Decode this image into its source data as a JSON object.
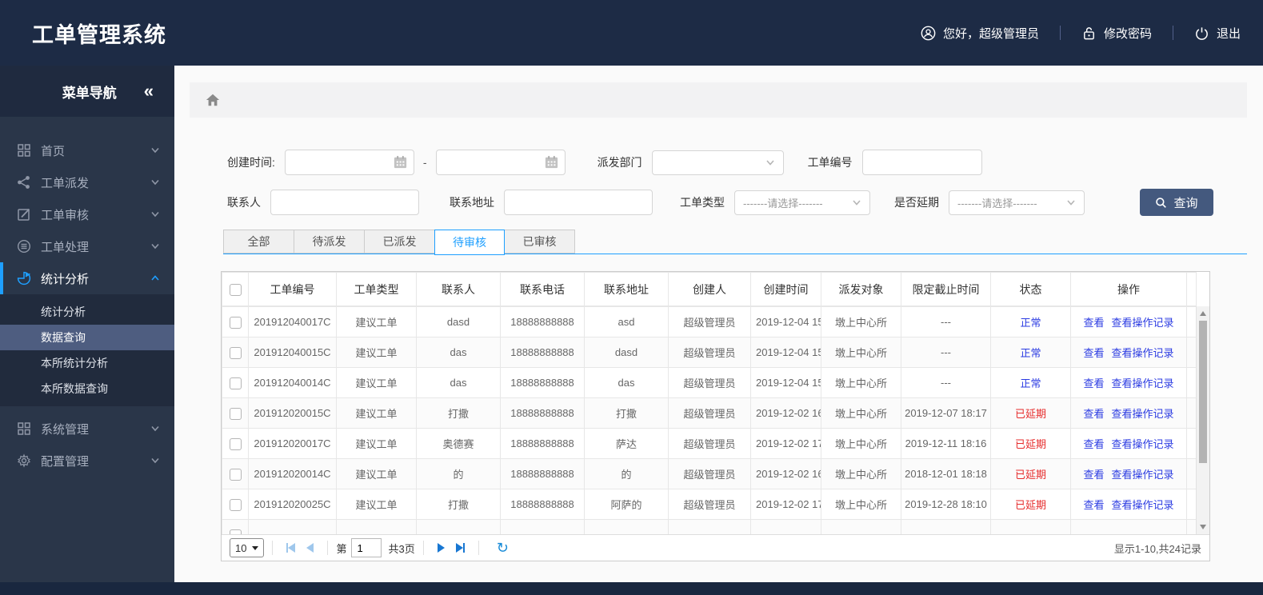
{
  "topbar": {
    "title": "工单管理系统",
    "greeting": "您好，超级管理员",
    "change_password": "修改密码",
    "logout": "退出"
  },
  "sidebar": {
    "header": "菜单导航",
    "collapse_icon": "«",
    "items": [
      {
        "label": "首页",
        "icon": "grid-icon"
      },
      {
        "label": "工单派发",
        "icon": "share-icon"
      },
      {
        "label": "工单审核",
        "icon": "edit-icon"
      },
      {
        "label": "工单处理",
        "icon": "database-icon"
      },
      {
        "label": "统计分析",
        "icon": "pie-icon",
        "active": true,
        "expanded": true,
        "children": [
          {
            "label": "统计分析"
          },
          {
            "label": "数据查询",
            "selected": true
          },
          {
            "label": "本所统计分析"
          },
          {
            "label": "本所数据查询"
          }
        ]
      },
      {
        "label": "系统管理",
        "icon": "apps-icon"
      },
      {
        "label": "配置管理",
        "icon": "gear-icon"
      }
    ]
  },
  "filters": {
    "create_time_label": "创建时间:",
    "date_separator": "-",
    "depart_label": "派发部门",
    "order_no_label": "工单编号",
    "contact_label": "联系人",
    "address_label": "联系地址",
    "type_label": "工单类型",
    "type_placeholder": "-------请选择-------",
    "delay_label": "是否延期",
    "delay_placeholder": "-------请选择-------",
    "search_button": "查询"
  },
  "tabs": [
    {
      "label": "全部"
    },
    {
      "label": "待派发"
    },
    {
      "label": "已派发"
    },
    {
      "label": "待审核",
      "active": true
    },
    {
      "label": "已审核"
    }
  ],
  "table": {
    "columns": [
      "工单编号",
      "工单类型",
      "联系人",
      "联系电话",
      "联系地址",
      "创建人",
      "创建时间",
      "派发对象",
      "限定截止时间",
      "状态",
      "操作"
    ],
    "rows": [
      {
        "order_no": "201912040017C",
        "type": "建议工单",
        "contact": "dasd",
        "phone": "18888888888",
        "address": "asd",
        "creator": "超级管理员",
        "created": "2019-12-04 15",
        "target": "墩上中心所",
        "deadline": "---",
        "status": "正常",
        "status_type": "normal",
        "actions": [
          "查看",
          "查看操作记录"
        ]
      },
      {
        "order_no": "201912040015C",
        "type": "建议工单",
        "contact": "das",
        "phone": "18888888888",
        "address": "dasd",
        "creator": "超级管理员",
        "created": "2019-12-04 15",
        "target": "墩上中心所",
        "deadline": "---",
        "status": "正常",
        "status_type": "normal",
        "actions": [
          "查看",
          "查看操作记录"
        ]
      },
      {
        "order_no": "201912040014C",
        "type": "建议工单",
        "contact": "das",
        "phone": "18888888888",
        "address": "das",
        "creator": "超级管理员",
        "created": "2019-12-04 15",
        "target": "墩上中心所",
        "deadline": "---",
        "status": "正常",
        "status_type": "normal",
        "actions": [
          "查看",
          "查看操作记录"
        ]
      },
      {
        "order_no": "201912020015C",
        "type": "建议工单",
        "contact": "打撒",
        "phone": "18888888888",
        "address": "打撒",
        "creator": "超级管理员",
        "created": "2019-12-02 16",
        "target": "墩上中心所",
        "deadline": "2019-12-07 18:17",
        "status": "已延期",
        "status_type": "delayed",
        "actions": [
          "查看",
          "查看操作记录"
        ]
      },
      {
        "order_no": "201912020017C",
        "type": "建议工单",
        "contact": "奥德赛",
        "phone": "18888888888",
        "address": "萨达",
        "creator": "超级管理员",
        "created": "2019-12-02 17",
        "target": "墩上中心所",
        "deadline": "2019-12-11 18:16",
        "status": "已延期",
        "status_type": "delayed",
        "actions": [
          "查看",
          "查看操作记录"
        ]
      },
      {
        "order_no": "201912020014C",
        "type": "建议工单",
        "contact": "的",
        "phone": "18888888888",
        "address": "的",
        "creator": "超级管理员",
        "created": "2019-12-02 16",
        "target": "墩上中心所",
        "deadline": "2018-12-01 18:18",
        "status": "已延期",
        "status_type": "delayed",
        "actions": [
          "查看",
          "查看操作记录"
        ]
      },
      {
        "order_no": "201912020025C",
        "type": "建议工单",
        "contact": "打撒",
        "phone": "18888888888",
        "address": "阿萨的",
        "creator": "超级管理员",
        "created": "2019-12-02 17",
        "target": "墩上中心所",
        "deadline": "2019-12-28 18:10",
        "status": "已延期",
        "status_type": "delayed",
        "actions": [
          "查看",
          "查看操作记录"
        ]
      }
    ]
  },
  "pagination": {
    "page_size": "10",
    "page_prefix": "第",
    "current_page": "1",
    "total_pages": "共3页",
    "summary": "显示1-10,共24记录"
  },
  "colors": {
    "accent_blue": "#1e9fff",
    "link_blue": "#2b3be2",
    "status_red": "#e62b2b",
    "button_blue": "#44597e",
    "topbar_bg": "#1d2b45"
  }
}
